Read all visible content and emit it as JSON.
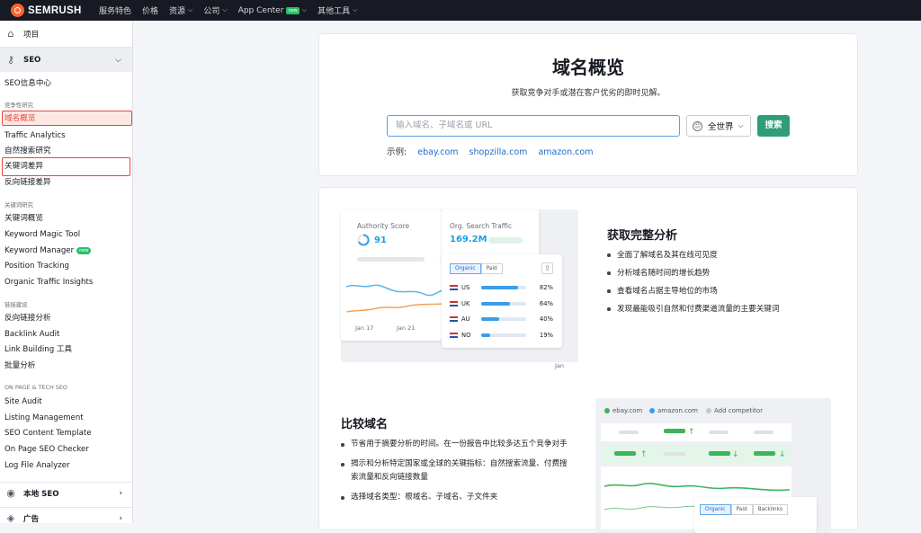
{
  "topnav": {
    "logo": "SEMRUSH",
    "items": [
      {
        "label": "服务特色",
        "dropdown": false
      },
      {
        "label": "价格",
        "dropdown": false
      },
      {
        "label": "资源",
        "dropdown": true
      },
      {
        "label": "公司",
        "dropdown": true
      },
      {
        "label": "App Center",
        "dropdown": true,
        "badge": "new"
      },
      {
        "label": "其他工具",
        "dropdown": true
      }
    ]
  },
  "sidebar": {
    "projects": "项目",
    "seo": "SEO",
    "seo_hub": "SEO信息中心",
    "sec_competitive": "竞争性研究",
    "domain_overview": "域名概览",
    "traffic_analytics": "Traffic Analytics",
    "organic_research": "自然搜索研究",
    "keyword_gap": "关键词差异",
    "backlink_gap": "反向链接差异",
    "sec_keyword": "关键词研究",
    "keyword_overview": "关键词概览",
    "keyword_magic": "Keyword Magic Tool",
    "keyword_manager": "Keyword Manager",
    "keyword_manager_badge": "new",
    "position_tracking": "Position Tracking",
    "organic_insights": "Organic Traffic Insights",
    "sec_link": "链接建设",
    "backlink_analytics": "反向链接分析",
    "backlink_audit": "Backlink Audit",
    "link_building": "Link Building 工具",
    "bulk_analysis": "批量分析",
    "sec_onpage": "ON PAGE & TECH SEO",
    "site_audit": "Site Audit",
    "listing_management": "Listing Management",
    "seo_content_template": "SEO Content Template",
    "onpage_checker": "On Page SEO Checker",
    "log_file_analyzer": "Log File Analyzer",
    "local_seo": "本地 SEO",
    "ads": "广告"
  },
  "hero": {
    "title": "域名概览",
    "subtitle": "获取竞争对手或潜在客户优劣的即时见解。",
    "search_placeholder": "输入域名、子域名或 URL",
    "region": "全世界",
    "search_button": "搜索",
    "examples_label": "示例:",
    "examples": [
      "ebay.com",
      "shopzilla.com",
      "amazon.com"
    ]
  },
  "feature1": {
    "heading": "获取完整分析",
    "bullets": [
      "全面了解域名及其在线可见度",
      "分析域名随时间的增长趋势",
      "查看域名占据主导地位的市场",
      "发现最能吸引自然和付费渠道流量的主要关键词"
    ],
    "authority_label": "Authority Score",
    "authority_value": "91",
    "traffic_label": "Org. Search Traffic",
    "traffic_value": "169.2M",
    "tab_organic": "Organic",
    "tab_paid": "Paid",
    "dates": [
      "Jan 17",
      "Jan 21",
      "Jan"
    ],
    "countries": [
      {
        "code": "US",
        "pct": "82%",
        "fill": 0.82
      },
      {
        "code": "UK",
        "pct": "64%",
        "fill": 0.64
      },
      {
        "code": "AU",
        "pct": "40%",
        "fill": 0.4
      },
      {
        "code": "NO",
        "pct": "19%",
        "fill": 0.19
      }
    ]
  },
  "feature2": {
    "heading": "比较域名",
    "bullets": [
      "节省用于摘要分析的时间。在一份报告中比较多达五个竞争对手",
      "揭示和分析特定国家或全球的关键指标：自然搜索流量、付费搜索流量和反向链接数量",
      "选择域名类型：根域名、子域名、子文件夹"
    ],
    "legend": [
      {
        "label": "ebay.com",
        "color": "#3cb55a"
      },
      {
        "label": "amazon.com",
        "color": "#3a9de8"
      },
      {
        "label": "Add competitor",
        "color": "#c7c9cf"
      }
    ],
    "tabs": [
      "Organic",
      "Paid",
      "Backlinks"
    ]
  }
}
